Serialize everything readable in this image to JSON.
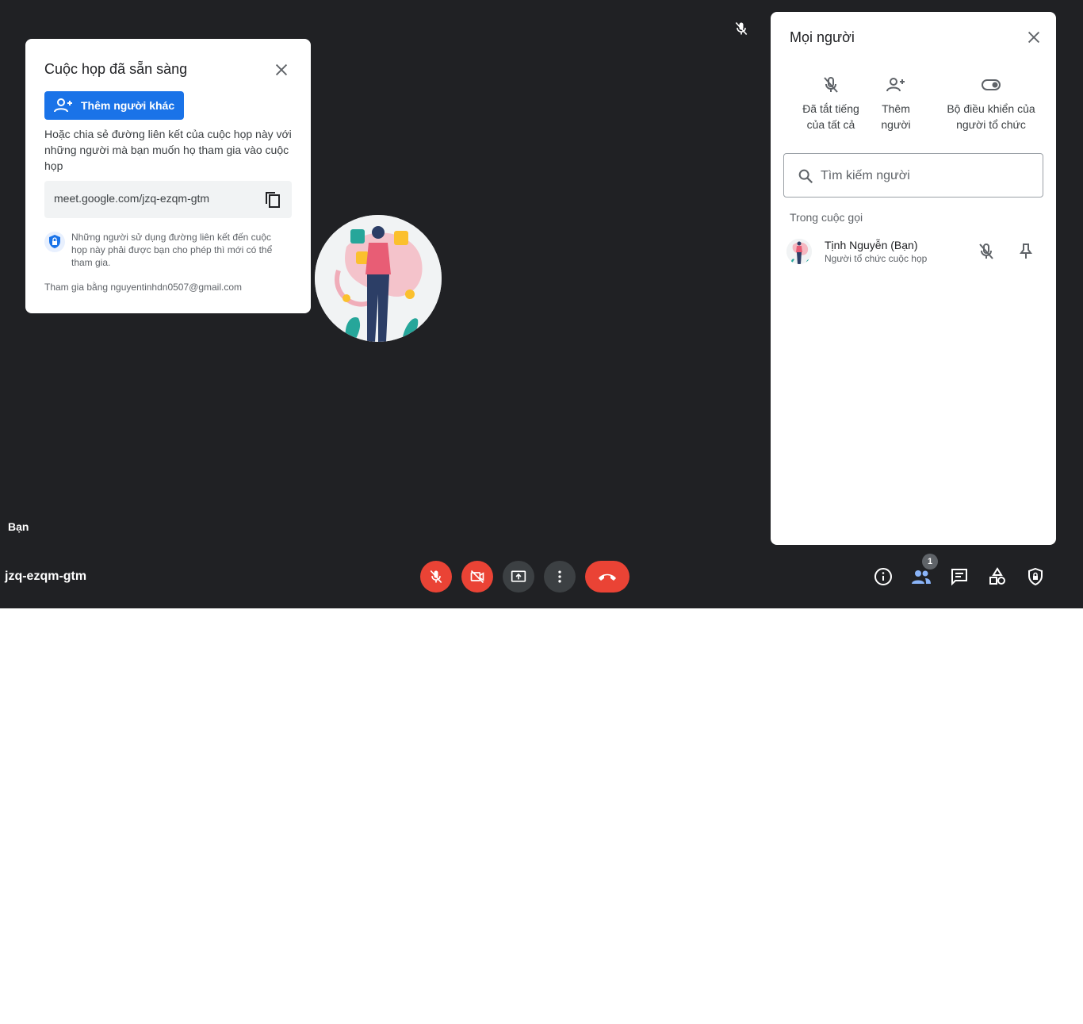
{
  "meeting": {
    "code": "jzq-ezqm-gtm",
    "self_label": "Bạn"
  },
  "ready_card": {
    "title": "Cuộc họp đã sẵn sàng",
    "add_button_label": "Thêm người khác",
    "share_text": "Hoặc chia sẻ đường liên kết của cuộc họp này với những người mà bạn muốn họ tham gia vào cuộc họp",
    "link": "meet.google.com/jzq-ezqm-gtm",
    "permission_text": "Những người sử dụng đường liên kết đến cuộc họp này phải được bạn cho phép thì mới có thể tham gia.",
    "joined_as": "Tham gia bằng nguyentinhdn0507@gmail.com"
  },
  "people_panel": {
    "title": "Mọi người",
    "actions": [
      {
        "label_line1": "Đã tắt tiếng",
        "label_line2": "của tất cả",
        "icon": "mic-off-icon"
      },
      {
        "label_line1": "Thêm",
        "label_line2": "người",
        "icon": "person-add-icon"
      },
      {
        "label_line1": "Bộ điều khiển của",
        "label_line2": "người tổ chức",
        "icon": "toggle-icon"
      }
    ],
    "search_placeholder": "Tìm kiếm người",
    "section_label": "Trong cuộc gọi",
    "participants": [
      {
        "name": "Tịnh Nguyễn (Bạn)",
        "role": "Người tổ chức cuộc họp"
      }
    ]
  },
  "toolbar": {
    "people_count": "1",
    "colors": {
      "red": "#ea4335",
      "dark": "#3c4043",
      "accent": "#1a73e8",
      "people_active": "#8ab4f8"
    }
  }
}
